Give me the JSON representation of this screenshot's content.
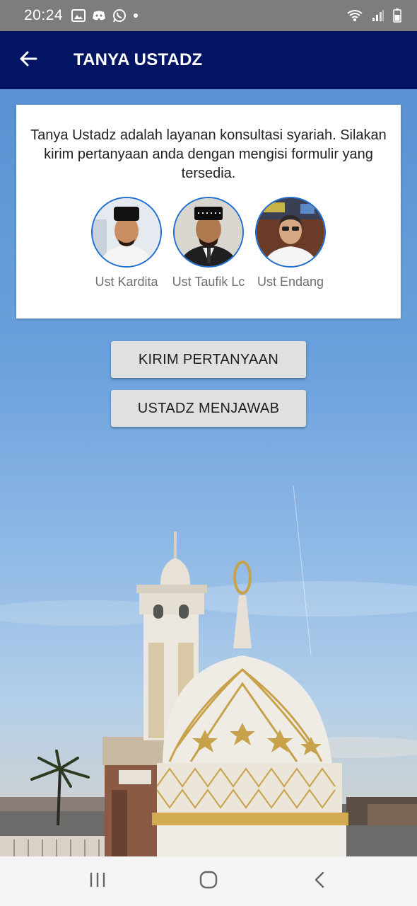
{
  "status_bar": {
    "time": "20:24",
    "left_icons": [
      "gallery-icon",
      "discord-icon",
      "whatsapp-icon",
      "dot-icon"
    ],
    "right_icons": [
      "wifi-icon",
      "signal-icon",
      "battery-icon"
    ]
  },
  "app_bar": {
    "title": "TANYA USTADZ",
    "back_icon": "arrow-left-icon",
    "background": "#031462"
  },
  "info_card": {
    "description": "Tanya Ustadz adalah layanan konsultasi syariah. Silakan kirim pertanyaan anda dengan mengisi formulir yang tersedia.",
    "ustadz": [
      {
        "name": "Ust Kardita"
      },
      {
        "name": "Ust Taufik Lc"
      },
      {
        "name": "Ust Endang"
      }
    ]
  },
  "actions": {
    "ask_label": "KIRIM PERTANYAAN",
    "answers_label": "USTADZ MENJAWAB"
  },
  "nav_bar": {
    "items": [
      "recent-apps-icon",
      "home-icon",
      "back-icon"
    ]
  },
  "colors": {
    "accent": "#031462",
    "avatar_ring": "#1f6fd0"
  }
}
